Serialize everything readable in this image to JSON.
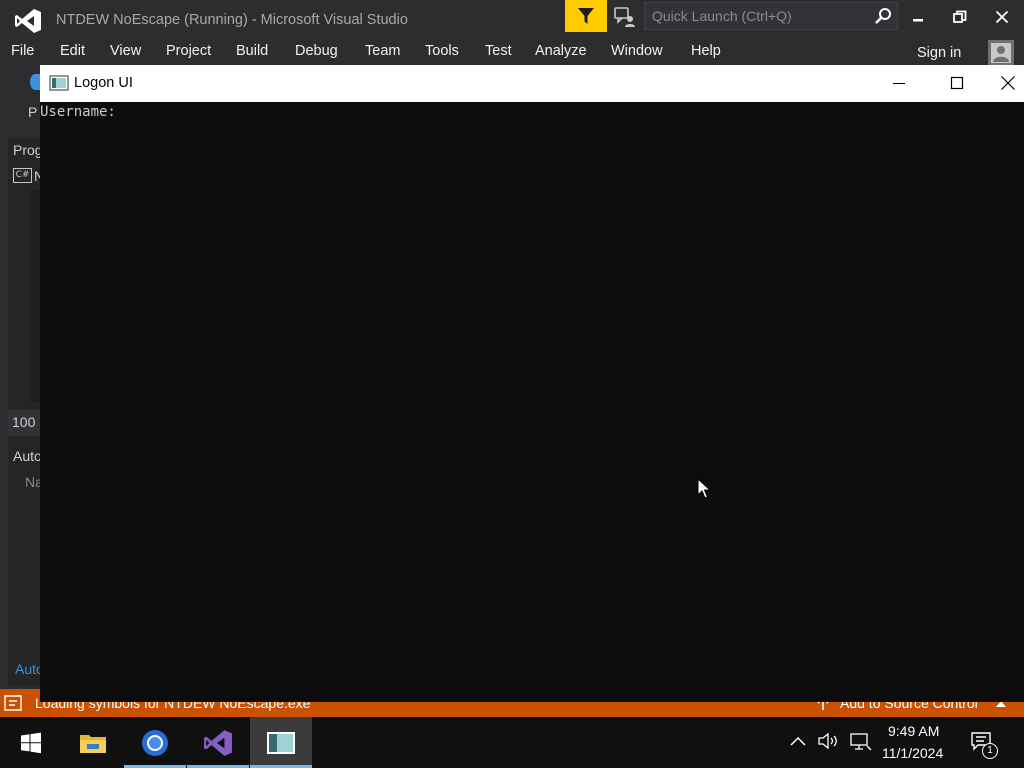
{
  "vs": {
    "title": "NTDEW NoEscape (Running) - Microsoft Visual Studio",
    "quick_launch_placeholder": "Quick Launch (Ctrl+Q)",
    "menu": [
      "File",
      "Edit",
      "View",
      "Project",
      "Build",
      "Debug",
      "Team",
      "Tools",
      "Test",
      "Analyze",
      "Window",
      "Help"
    ],
    "sign_in": "Sign in",
    "peek": {
      "top_fragment": "P",
      "panel_header": "Prog",
      "project_badge": "C#",
      "project_fragment": "N",
      "zoom": "100",
      "autos_header": "Auto",
      "name_column": "Na",
      "autos_tab": "Auto"
    },
    "status": {
      "text": "Loading symbols for NTDEW NoEscape.exe",
      "source_control": "Add to Source Control"
    }
  },
  "console": {
    "title": "Logon UI",
    "output": "Username:"
  },
  "taskbar": {
    "apps": [
      "start-button",
      "file-explorer",
      "chrome",
      "visual-studio",
      "logon-ui-console"
    ],
    "clock_time": "9:49 AM",
    "clock_date": "11/1/2024",
    "notification_count": "1"
  },
  "colors": {
    "vs_chrome": "#2d2d30",
    "status_bar": "#ca5100",
    "filter_button": "#ffcc00",
    "console_bg": "#0c0c0c",
    "taskbar": "#101010",
    "vs_purple": "#865fc5"
  }
}
